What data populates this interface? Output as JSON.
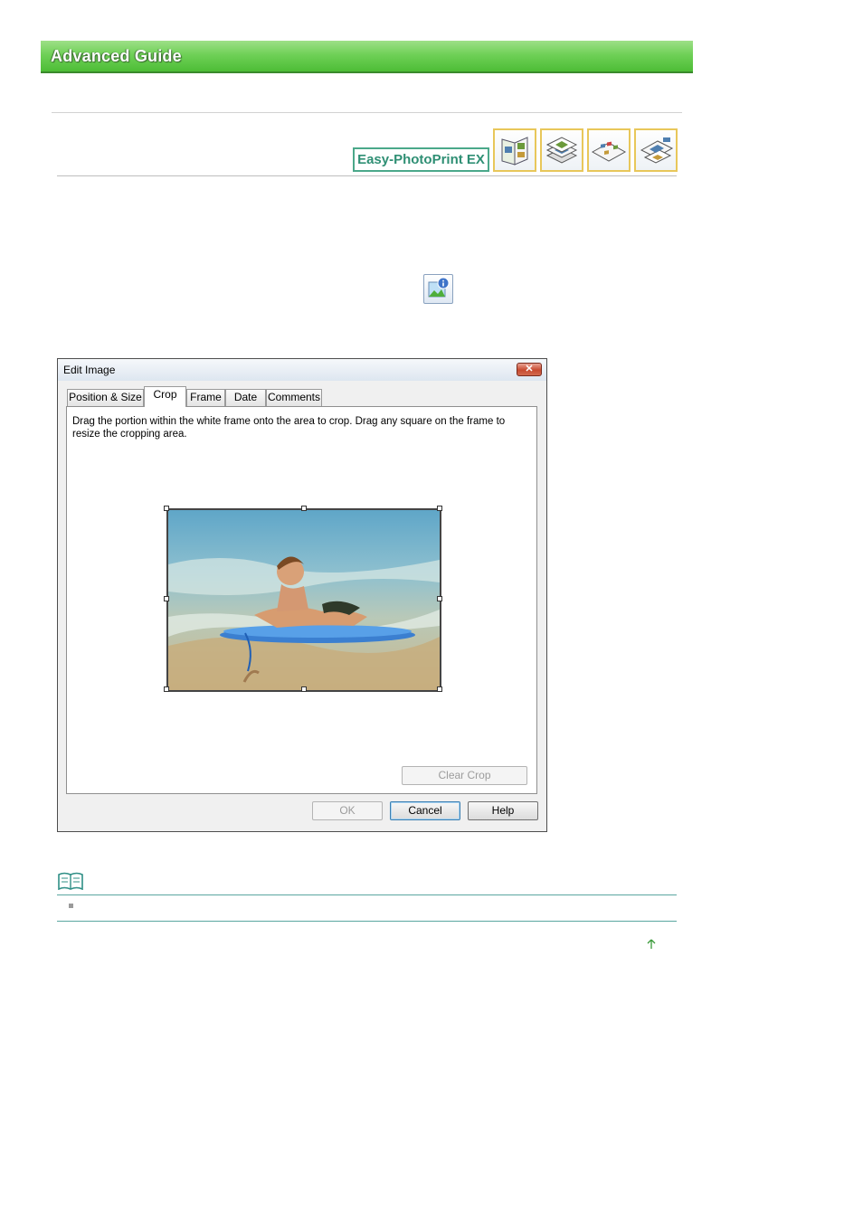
{
  "header": {
    "title": "Advanced Guide"
  },
  "product": {
    "label": "Easy-PhotoPrint EX",
    "icons": [
      "album-icon",
      "layout-print-icon",
      "sticker-icon",
      "calendar-icon"
    ]
  },
  "inline_icon": "image-info-icon",
  "dialog": {
    "title": "Edit Image",
    "close_label": "✕",
    "tabs": [
      "Position & Size",
      "Crop",
      "Frame",
      "Date",
      "Comments"
    ],
    "active_tab": "Crop",
    "instruction": "Drag the portion within the white frame onto the area to crop. Drag any square on the frame to resize the cropping area.",
    "clear_crop_label": "Clear Crop",
    "ok_label": "OK",
    "cancel_label": "Cancel",
    "help_label": "Help"
  },
  "note": {
    "icon": "note-book-icon"
  },
  "footer": {
    "page_top_icon": "page-top-arrow-icon"
  },
  "colors": {
    "banner_green": "#5cc646",
    "accent_teal": "#4ba88a",
    "note_line": "#5aa6a0"
  }
}
